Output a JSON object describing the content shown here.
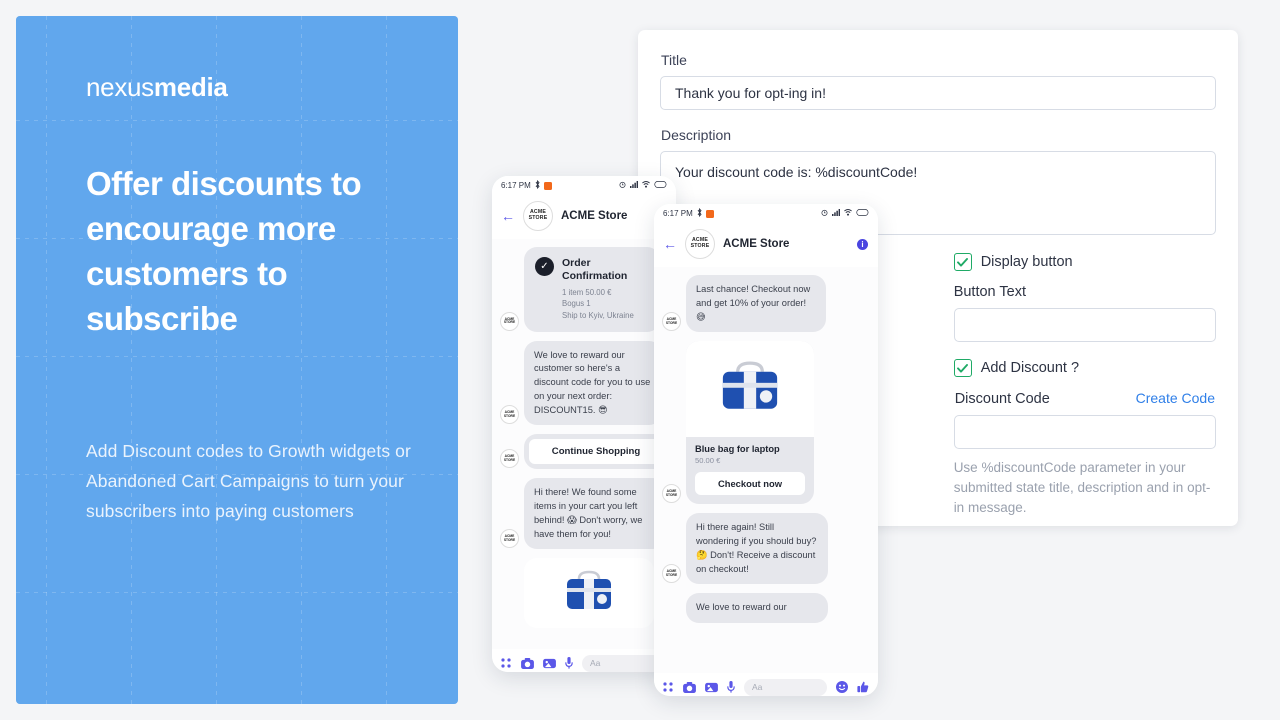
{
  "promo": {
    "logo_light": "nexus",
    "logo_bold": "media",
    "headline": "Offer discounts to encourage more customers to subscribe",
    "body": "Add Discount codes to Growth widgets or Abandoned Cart Campaigns to turn your subscribers into paying customers",
    "bg_color": "#1a80e4"
  },
  "form": {
    "title_label": "Title",
    "title_value": "Thank you for opt-ing in!",
    "description_label": "Description",
    "description_value": "Your discount code is: %discountCode!",
    "display_button_label": "Display button",
    "display_button_checked": true,
    "button_text_label": "Button Text",
    "button_text_value": "",
    "add_discount_label": "Add Discount ?",
    "add_discount_checked": true,
    "discount_code_label": "Discount Code",
    "create_code_link": "Create Code",
    "discount_code_value": "",
    "hint": "Use %discountCode parameter in your submitted state title, description and in opt-in message.",
    "checkbox_color": "#1faa66",
    "link_color": "#2f7fe8"
  },
  "phone_back": {
    "status_time": "6:17 PM",
    "store_name": "ACME Store",
    "avatar_text": "ACME STORE",
    "messages": [
      {
        "type": "order",
        "title": "Order Confirmation",
        "meta_lines": [
          "1 item 50.00 €",
          "Bogus 1",
          "Ship to Kyiv, Ukraine"
        ]
      },
      {
        "type": "text",
        "text": "We love to reward our customer so here's a discount code for you to use on your next order: DISCOUNT15. 😎"
      },
      {
        "type": "button",
        "label": "Continue Shopping"
      },
      {
        "type": "text",
        "text": "Hi there! We found some items in your cart you left behind! 😱 Don't worry, we have them for you!"
      },
      {
        "type": "product_partial"
      }
    ],
    "composer_placeholder": "Aa"
  },
  "phone_front": {
    "status_time": "6:17 PM",
    "store_name": "ACME Store",
    "avatar_text": "ACME STORE",
    "messages": [
      {
        "type": "text",
        "text": "Last chance! Checkout now and get 10% of your order! 😅"
      },
      {
        "type": "product",
        "name": "Blue bag for laptop",
        "price": "50.00 €",
        "button": "Checkout now"
      },
      {
        "type": "text",
        "text": "Hi there again! Still wondering if you should buy? 🤔 Don't! Receive a discount on checkout!"
      },
      {
        "type": "text_partial",
        "text": "We love to reward our"
      }
    ],
    "composer_placeholder": "Aa"
  }
}
